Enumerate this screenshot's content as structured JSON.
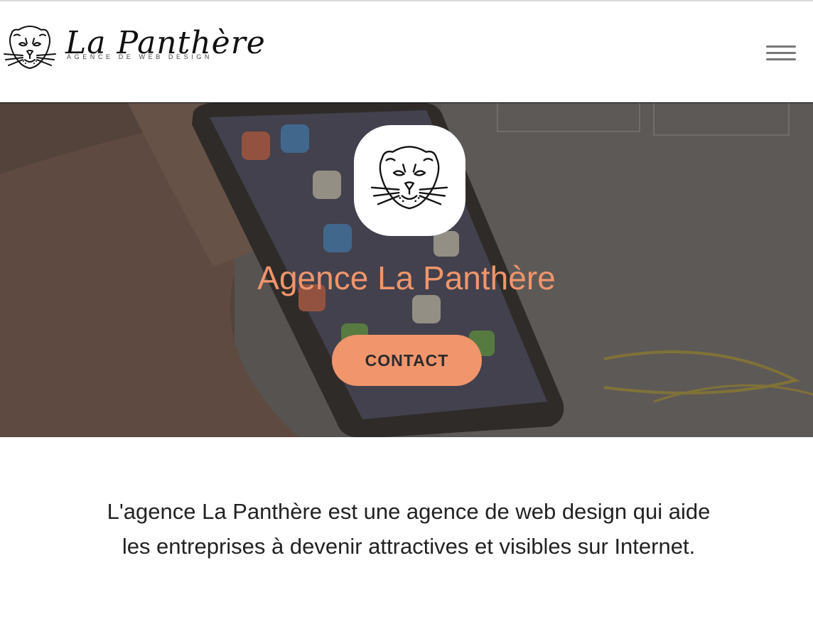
{
  "header": {
    "logo_name": "La Panthère",
    "logo_tagline": "AGENCE DE WEB DESIGN",
    "menu_icon": "hamburger-menu-icon"
  },
  "hero": {
    "badge_icon": "panther-head-icon",
    "title": "Agence La Panthère",
    "contact_label": "CONTACT"
  },
  "intro": {
    "text": "L'agence La Panthère est une agence de web design qui aide les entreprises à devenir attractives et visibles sur Internet."
  },
  "colors": {
    "accent": "#f0956c",
    "text": "#222222",
    "background": "#ffffff"
  }
}
